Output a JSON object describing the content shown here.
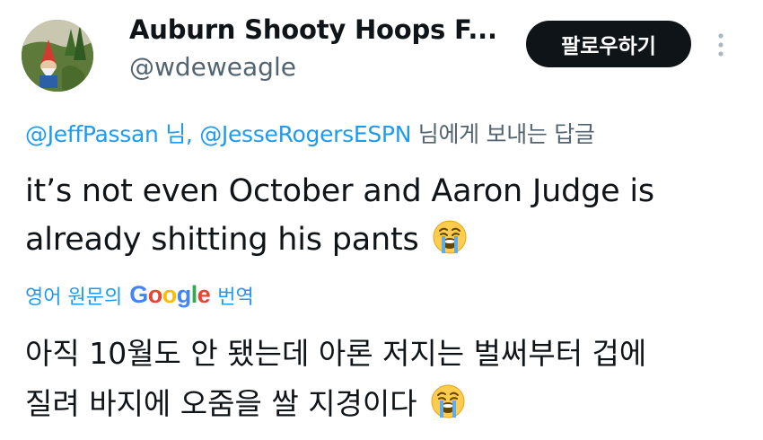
{
  "author": {
    "display_name": "Auburn Shooty Hoops F...",
    "handle": "@wdeweagle"
  },
  "follow_button_label": "팔로우하기",
  "reply_context": {
    "mention_1": "@JeffPassan",
    "separator": " 님, ",
    "mention_2": "@JesseRogersESPN",
    "suffix": " 님에게 보내는 답글"
  },
  "tweet": {
    "line1": "it’s not even October and Aaron Judge is",
    "line2": "already shitting his pants"
  },
  "translate": {
    "prefix": "영어 원문의",
    "brand": {
      "g1": "G",
      "g2": "o",
      "g3": "o",
      "g4": "g",
      "g5": "l",
      "g6": "e"
    },
    "suffix": "번역"
  },
  "translated": {
    "line1": "아직 10월도 안 됐는데 아론 저지는 벌써부터 겁에",
    "line2": "질려 바지에 오줌을 쌀 지경이다"
  },
  "emoji": "loudly-crying-face",
  "colors": {
    "link_blue": "#1d9bf0",
    "text_primary": "#0f1419",
    "text_secondary": "#536471",
    "button_bg": "#0f1419"
  }
}
